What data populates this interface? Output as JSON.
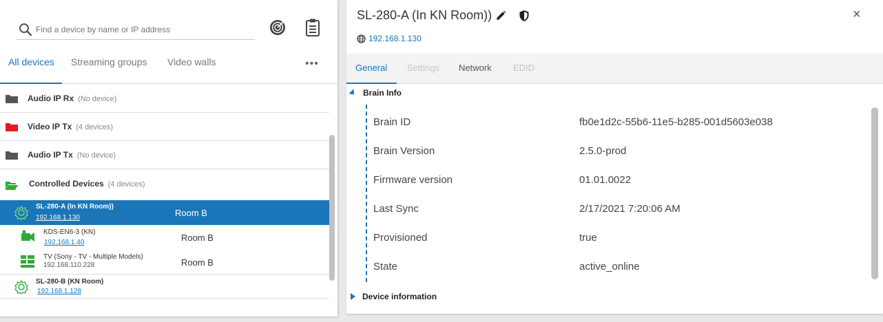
{
  "left": {
    "search": {
      "placeholder": "Find a device by name or IP address"
    },
    "icons": {
      "radar": "radar-icon",
      "clipboard": "clipboard-icon"
    },
    "tabs": [
      {
        "label": "All devices"
      },
      {
        "label": "Streaming groups"
      },
      {
        "label": "Video walls"
      }
    ],
    "more_label": "•••",
    "groups": [
      {
        "name": "Audio IP Rx",
        "count": "(No device)",
        "color": "#555555"
      },
      {
        "name": "Video IP Tx",
        "count": "(4 devices)",
        "color": "#e11d1d"
      },
      {
        "name": "Audio IP Tx",
        "count": "(No device)",
        "color": "#555555"
      },
      {
        "name": "Controlled Devices",
        "count": "(4 devices)",
        "color": "#2eaa3a"
      }
    ],
    "devices": [
      {
        "name": "SL-280-A (In KN Room))",
        "ip": "192.168.1.130",
        "room": "Room B",
        "icon": "gear-icon"
      },
      {
        "name": "KDS-EN6-3 (KN)",
        "ip": "192.168.1.40",
        "room": "Room B",
        "icon": "video-encoder-icon"
      },
      {
        "name": "TV (Sony - TV - Multiple Models)",
        "ip": "192.168.110.228",
        "room": "Room B",
        "icon": "display-device-icon"
      },
      {
        "name": "SL-280-B (KN Room)",
        "ip": "192.168.1.128",
        "room": "",
        "icon": "gear-icon"
      }
    ]
  },
  "right": {
    "title": "SL-280-A (In KN Room))",
    "ip": "192.168.1.130",
    "close": "×",
    "tabs": [
      {
        "label": "General",
        "state": "active"
      },
      {
        "label": "Settings",
        "state": "disabled"
      },
      {
        "label": "Network",
        "state": "normal"
      },
      {
        "label": "EDID",
        "state": "disabled"
      }
    ],
    "section_brain": "Brain Info",
    "info": [
      {
        "label": "Brain ID",
        "value": "fb0e1d2c-55b6-11e5-b285-001d5603e038"
      },
      {
        "label": "Brain Version",
        "value": "2.5.0-prod"
      },
      {
        "label": "Firmware version",
        "value": "01.01.0022"
      },
      {
        "label": "Last Sync",
        "value": "2/17/2021 7:20:06 AM"
      },
      {
        "label": "Provisioned",
        "value": "true"
      },
      {
        "label": "State",
        "value": "active_online"
      }
    ],
    "section_device": "Device information"
  },
  "colors": {
    "accent": "#1a76b8"
  }
}
